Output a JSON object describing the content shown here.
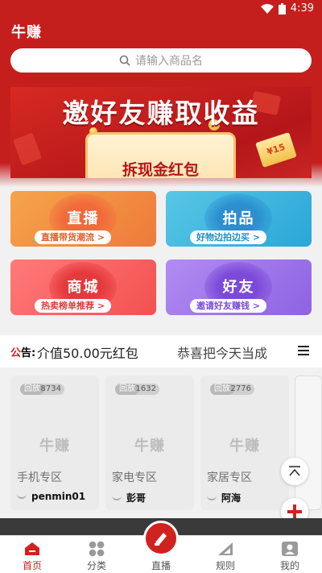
{
  "status_bar": {
    "time": "4:39"
  },
  "header": {
    "logo": "牛赚",
    "search_placeholder": "请输入商品名"
  },
  "banner": {
    "title": "邀好友赚取收益",
    "card_text": "拆现金红包",
    "ticket_text": "¥15"
  },
  "categories": [
    {
      "name": "直播",
      "tagline": "直播带货潮流 >"
    },
    {
      "name": "拍品",
      "tagline": "好物边拍边买 >"
    },
    {
      "name": "商城",
      "tagline": "热卖榜单推荐 >"
    },
    {
      "name": "好友",
      "tagline": "邀请好友赚钱 >"
    }
  ],
  "notice": {
    "label_a": "公",
    "label_b": "告:",
    "text": "介值50.00元红包",
    "text2": "恭喜把今天当成"
  },
  "live_cards": [
    {
      "badge": "回放",
      "count": "8734",
      "watermark": "牛赚",
      "zone": "手机专区",
      "user": "penmin01"
    },
    {
      "badge": "回放",
      "count": "1632",
      "watermark": "牛赚",
      "zone": "家电专区",
      "user": "彭哥"
    },
    {
      "badge": "回放",
      "count": "2776",
      "watermark": "牛赚",
      "zone": "家居专区",
      "user": "阿海"
    }
  ],
  "tabbar": {
    "items": [
      {
        "label": "首页",
        "icon": "home-icon"
      },
      {
        "label": "分类",
        "icon": "grid-icon"
      },
      {
        "label": "直播",
        "icon": "live-icon"
      },
      {
        "label": "规则",
        "icon": "ruler-icon"
      },
      {
        "label": "我的",
        "icon": "user-icon"
      }
    ]
  },
  "colors": {
    "brand": "#c41f1d",
    "accent": "#d0221f"
  }
}
